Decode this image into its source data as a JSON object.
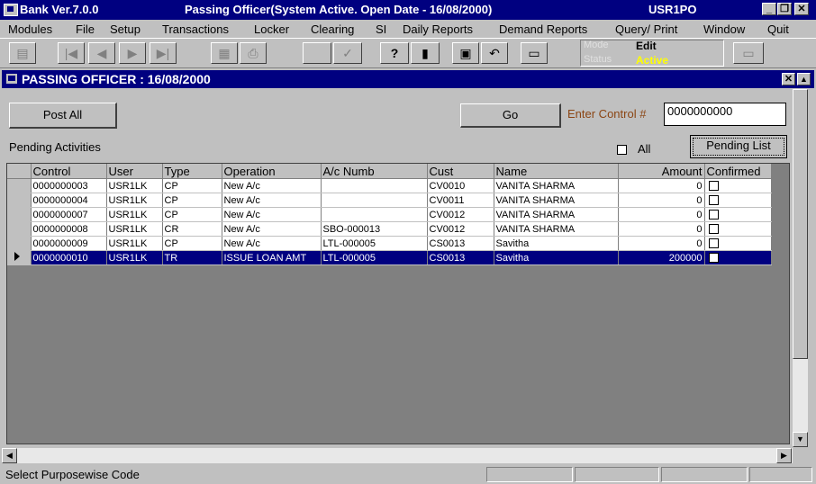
{
  "window": {
    "app_title": "Bank Ver.7.0.0",
    "caption": "Passing Officer(System Active. Open Date - 16/08/2000)",
    "user": "USR1PO"
  },
  "menu": [
    "Modules",
    "File",
    "Setup",
    "Transactions",
    "Locker",
    "Clearing",
    "SI",
    "Daily Reports",
    "Demand Reports",
    "Query/ Print",
    "Window",
    "Quit"
  ],
  "toolbar": {
    "mode_label": "Mode",
    "mode_value": "Edit",
    "status_label": "Status",
    "status_value": "Active",
    "help_glyph": "?"
  },
  "form": {
    "title": "PASSING OFFICER : 16/08/2000",
    "post_all": "Post All",
    "go": "Go",
    "enter_control_label": "Enter Control #",
    "control_value": "0000000000",
    "pending_activities": "Pending Activities",
    "all_label": "All",
    "pending_list": "Pending List"
  },
  "grid": {
    "columns": [
      "Control",
      "User",
      "Type",
      "Operation",
      "A/c Numb",
      "Cust",
      "Name",
      "Amount",
      "Confirmed"
    ],
    "rows": [
      {
        "control": "0000000003",
        "user": "USR1LK",
        "type": "CP",
        "operation": "New A/c",
        "acnumb": "",
        "cust": "CV0010",
        "name": "VANITA SHARMA",
        "amount": "0"
      },
      {
        "control": "0000000004",
        "user": "USR1LK",
        "type": "CP",
        "operation": "New A/c",
        "acnumb": "",
        "cust": "CV0011",
        "name": "VANITA SHARMA",
        "amount": "0"
      },
      {
        "control": "0000000007",
        "user": "USR1LK",
        "type": "CP",
        "operation": "New A/c",
        "acnumb": "",
        "cust": "CV0012",
        "name": "VANITA SHARMA",
        "amount": "0"
      },
      {
        "control": "0000000008",
        "user": "USR1LK",
        "type": "CR",
        "operation": "New A/c",
        "acnumb": "SBO-000013",
        "cust": "CV0012",
        "name": "VANITA SHARMA",
        "amount": "0"
      },
      {
        "control": "0000000009",
        "user": "USR1LK",
        "type": "CP",
        "operation": "New A/c",
        "acnumb": "LTL-000005",
        "cust": "CS0013",
        "name": "Savitha",
        "amount": "0"
      },
      {
        "control": "0000000010",
        "user": "USR1LK",
        "type": "TR",
        "operation": "ISSUE LOAN AMT",
        "acnumb": "LTL-000005",
        "cust": "CS0013",
        "name": "Savitha",
        "amount": "200000"
      }
    ],
    "selected_index": 5
  },
  "status": {
    "text": "Select Purposewise Code"
  }
}
